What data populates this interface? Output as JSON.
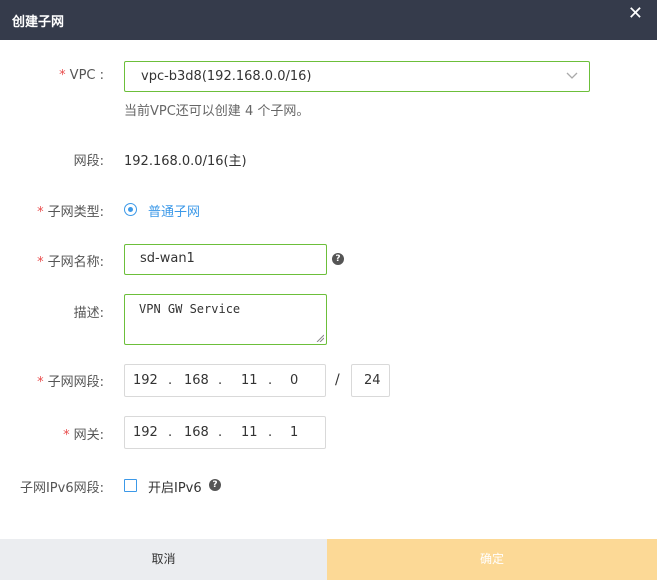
{
  "dialog": {
    "title": "创建子网",
    "close_glyph": "✕"
  },
  "form": {
    "vpc": {
      "label": "VPC :",
      "value": "vpc-b3d8(192.168.0.0/16)",
      "hint": "当前VPC还可以创建 4 个子网。"
    },
    "segment": {
      "label": "网段:",
      "value": "192.168.0.0/16(主)"
    },
    "subnet_type": {
      "label": "子网类型:",
      "option": "普通子网",
      "selected": true
    },
    "subnet_name": {
      "label": "子网名称:",
      "value": "sd-wan1"
    },
    "description": {
      "label": "描述:",
      "value": "VPN GW Service"
    },
    "subnet_cidr": {
      "label": "子网网段:",
      "octets": [
        "192",
        "168",
        "11",
        "0"
      ],
      "mask": "24",
      "separator": "/"
    },
    "gateway": {
      "label": "网关:",
      "octets": [
        "192",
        "168",
        "11",
        "1"
      ]
    },
    "ipv6": {
      "label": "子网IPv6网段:",
      "checkbox_label": "开启IPv6",
      "checked": false
    },
    "required_mark": "*",
    "octet_separator": "."
  },
  "footer": {
    "cancel_label": "取消",
    "ok_label": "确定"
  },
  "colors": {
    "titlebar": "#353b4b",
    "accent_blue": "#3c99e8",
    "valid_green": "#6cbf3a",
    "required_red": "#e94b4b",
    "ok_button": "#fcd996",
    "cancel_button": "#ebedf0"
  },
  "icons": [
    "close-icon",
    "chevron-down-icon",
    "help-icon"
  ]
}
